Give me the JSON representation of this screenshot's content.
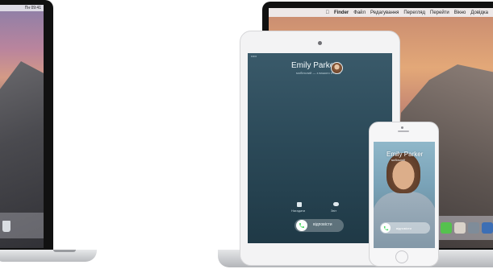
{
  "left_laptop": {
    "clock": "Пн 09:41"
  },
  "right_laptop": {
    "menu": {
      "apple": "",
      "items": [
        "Finder",
        "Файл",
        "Редагування",
        "Перегляд",
        "Перейти",
        "Вікно",
        "Довідка"
      ]
    }
  },
  "ipad": {
    "status": "•••••",
    "caller_name": "Emily Parker",
    "caller_sub": "мобільний — з вашого iPhone",
    "remind_label": "Нагадати",
    "message_label": "Звіт",
    "slider_label": "відповісти"
  },
  "iphone": {
    "caller_name": "Emily Parker",
    "caller_sub": "мобільний",
    "slider_label": "відповісти"
  },
  "colors": {
    "call_green": "#4cd964",
    "ipad_call_bg": "#2c4a59"
  }
}
